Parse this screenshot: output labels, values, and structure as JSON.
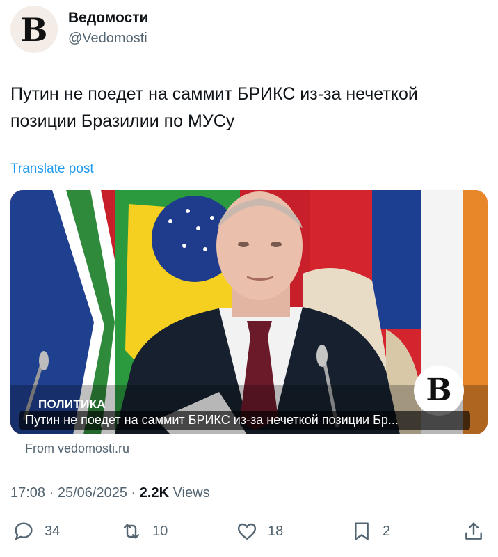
{
  "author": {
    "avatar_letter": "В",
    "name": "Ведомости",
    "handle": "@Vedomosti"
  },
  "tweet": {
    "text": "Путин не поедет на саммит БРИКС из-за нечеткой позиции Бразилии по МУСу",
    "translate_label": "Translate post"
  },
  "card": {
    "category": "ПОЛИТИКА",
    "title": "Путин не поедет на саммит БРИКС из-за нечеткой позиции Бр...",
    "logo_letter": "В",
    "source": "From vedomosti.ru"
  },
  "meta": {
    "time": "17:08",
    "separator": "·",
    "date": "25/06/2025",
    "views_count": "2.2K",
    "views_label": "Views"
  },
  "actions": {
    "replies": "34",
    "reposts": "10",
    "likes": "18",
    "bookmarks": "2"
  },
  "colors": {
    "link": "#1d9bf0",
    "secondary_text": "#536471",
    "primary_text": "#0f1419"
  }
}
